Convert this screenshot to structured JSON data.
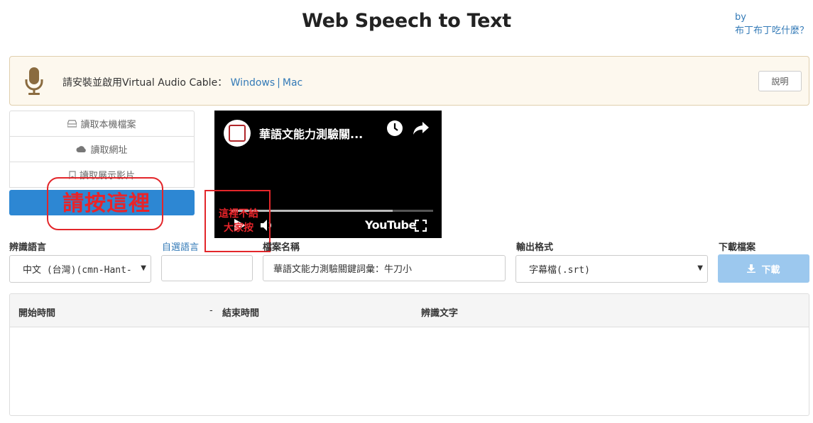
{
  "header": {
    "title": "Web Speech to Text",
    "by_label": "by",
    "author": "布丁布丁吃什麼？"
  },
  "notice": {
    "icon": "microphone-icon",
    "text": "請安裝並啟用Virtual Audio Cable：",
    "link_windows": "Windows",
    "separator": "|",
    "link_mac": "Mac",
    "help_button": "說明"
  },
  "sources": {
    "items": [
      {
        "icon": "drive-icon",
        "label": "讀取本機檔案"
      },
      {
        "icon": "cloud-icon",
        "label": "讀取網址"
      },
      {
        "icon": "bookmark-icon",
        "label": "讀取展示影片"
      }
    ]
  },
  "annotations": {
    "big_text": "請按這裡",
    "small_line1": "這裡不給",
    "small_line2": "大家按"
  },
  "video": {
    "title": "華語文能力測驗關...",
    "brand": "YouTube",
    "progress": 0.8
  },
  "form": {
    "lang_label": "辨識語言",
    "lang_value": "中文 (台灣)(cmn-Hant-",
    "custom_lang_label": "自選語言",
    "custom_lang_value": "",
    "filename_label": "檔案名稱",
    "filename_value": "華語文能力測驗關鍵詞彙：牛刀小",
    "format_label": "輸出格式",
    "format_value": "字幕檔(.srt)",
    "download_label": "下載檔案",
    "download_button": "下載"
  },
  "table": {
    "col_start": "開始時間",
    "col_dash": "-",
    "col_end": "結束時間",
    "col_text": "辨識文字"
  },
  "colors": {
    "primary": "#2d87d3",
    "download_disabled": "#9cc8ee",
    "annotation_red": "#e3262a",
    "notice_bg": "#fdf8ee"
  }
}
